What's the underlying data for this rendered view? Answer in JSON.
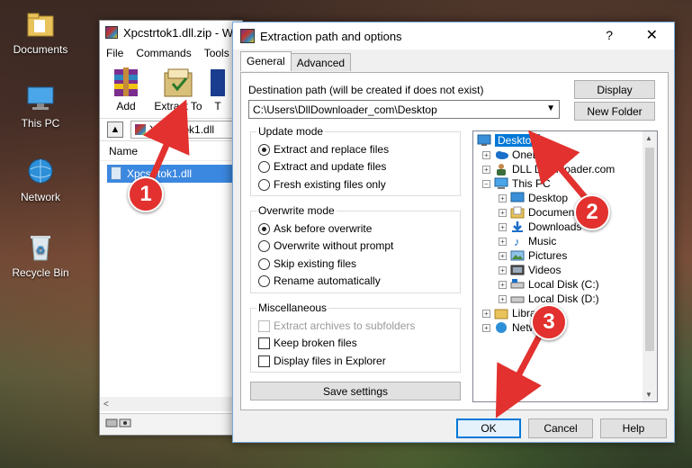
{
  "desktop": {
    "icons": [
      {
        "label": "Documents",
        "icon": "folder-icon"
      },
      {
        "label": "This PC",
        "icon": "computer-icon"
      },
      {
        "label": "Network",
        "icon": "network-icon"
      },
      {
        "label": "Recycle Bin",
        "icon": "recycle-bin-icon"
      }
    ]
  },
  "winrar": {
    "title": "Xpcstrtok1.dll.zip - W",
    "menu": [
      "File",
      "Commands",
      "Tools"
    ],
    "toolbar": {
      "add_label": "Add",
      "extract_label": "Extract To",
      "extra_label": "T"
    },
    "path": "Xpcstrtok1.dll",
    "column_name": "Name",
    "file_row": "Xpcstrtok1.dll"
  },
  "dialog": {
    "title": "Extraction path and options",
    "help": "?",
    "close": "✕",
    "tabs": [
      "General",
      "Advanced"
    ],
    "dest_label": "Destination path (will be created if does not exist)",
    "dest_value": "C:\\Users\\DllDownloader_com\\Desktop",
    "display_button": "Display",
    "new_folder_button": "New Folder",
    "update_mode": {
      "title": "Update mode",
      "options": [
        "Extract and replace files",
        "Extract and update files",
        "Fresh existing files only"
      ],
      "selected": 0
    },
    "overwrite_mode": {
      "title": "Overwrite mode",
      "options": [
        "Ask before overwrite",
        "Overwrite without prompt",
        "Skip existing files",
        "Rename automatically"
      ],
      "selected": 0
    },
    "misc": {
      "title": "Miscellaneous",
      "options": [
        "Extract archives to subfolders",
        "Keep broken files",
        "Display files in Explorer"
      ]
    },
    "save_settings": "Save settings",
    "tree": [
      {
        "label": "Desktop",
        "level": 0,
        "expander": "",
        "icon": "desktop-icon",
        "selected": true
      },
      {
        "label": "OneDrive",
        "level": 1,
        "expander": "+",
        "icon": "onedrive-icon"
      },
      {
        "label": "DLL Downloader.com",
        "level": 1,
        "expander": "+",
        "icon": "user-icon"
      },
      {
        "label": "This PC",
        "level": 1,
        "expander": "−",
        "icon": "computer-icon"
      },
      {
        "label": "Desktop",
        "level": 2,
        "expander": "+",
        "icon": "desktop-icon"
      },
      {
        "label": "Documents",
        "level": 2,
        "expander": "+",
        "icon": "documents-icon"
      },
      {
        "label": "Downloads",
        "level": 2,
        "expander": "+",
        "icon": "downloads-icon"
      },
      {
        "label": "Music",
        "level": 2,
        "expander": "+",
        "icon": "music-icon"
      },
      {
        "label": "Pictures",
        "level": 2,
        "expander": "+",
        "icon": "pictures-icon"
      },
      {
        "label": "Videos",
        "level": 2,
        "expander": "+",
        "icon": "videos-icon"
      },
      {
        "label": "Local Disk (C:)",
        "level": 2,
        "expander": "+",
        "icon": "drive-icon"
      },
      {
        "label": "Local Disk (D:)",
        "level": 2,
        "expander": "+",
        "icon": "drive-icon"
      },
      {
        "label": "Libraries",
        "level": 1,
        "expander": "+",
        "icon": "libraries-icon"
      },
      {
        "label": "Network",
        "level": 1,
        "expander": "+",
        "icon": "network-icon"
      }
    ],
    "ok_button": "OK",
    "cancel_button": "Cancel",
    "help_button": "Help"
  },
  "annotations": [
    "1",
    "2",
    "3"
  ],
  "colors": {
    "accent": "#0078d7",
    "badge": "#e2312e"
  }
}
